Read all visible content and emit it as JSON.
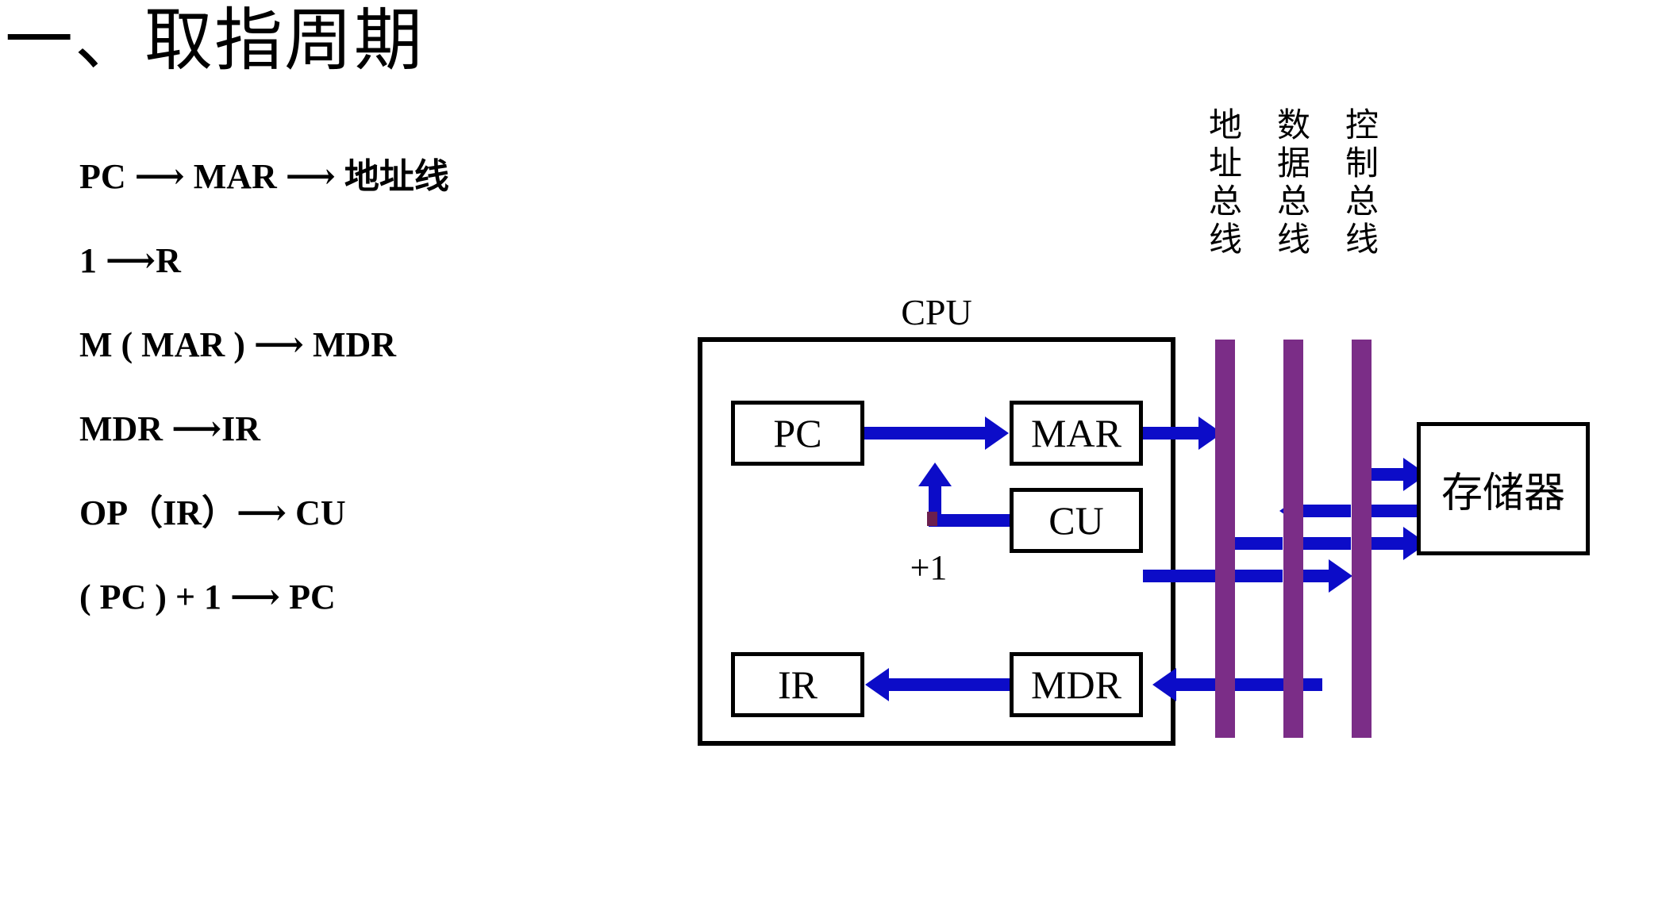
{
  "slide": {
    "title": "一、取指周期",
    "background": "#ffffff"
  },
  "colors": {
    "text": "#000000",
    "arrow_blue": "#0C0CC8",
    "bus_purple": "#7B2D87",
    "corner_marker": "#6B1F4E"
  },
  "operations": [
    {
      "id": "op1",
      "text": "PC ⟶ MAR ⟶ 地址线"
    },
    {
      "id": "op2",
      "text": "1 ⟶R"
    },
    {
      "id": "op3",
      "text": "M ( MAR ) ⟶ MDR"
    },
    {
      "id": "op4",
      "text": "MDR ⟶IR"
    },
    {
      "id": "op5",
      "text": "OP（IR）⟶ CU"
    },
    {
      "id": "op6",
      "text": "( PC ) + 1 ⟶ PC"
    }
  ],
  "diagram": {
    "cpu_label": "CPU",
    "registers": {
      "pc": "PC",
      "mar": "MAR",
      "cu": "CU",
      "ir": "IR",
      "mdr": "MDR"
    },
    "increment_label": "+1",
    "memory_label": "存储器",
    "buses": [
      {
        "id": "address",
        "caption": [
          "地",
          "址",
          "总",
          "线"
        ],
        "color": "#7B2D87"
      },
      {
        "id": "data",
        "caption": [
          "数",
          "据",
          "总",
          "线"
        ],
        "color": "#7B2D87"
      },
      {
        "id": "control",
        "caption": [
          "控",
          "制",
          "总",
          "线"
        ],
        "color": "#7B2D87"
      }
    ]
  }
}
